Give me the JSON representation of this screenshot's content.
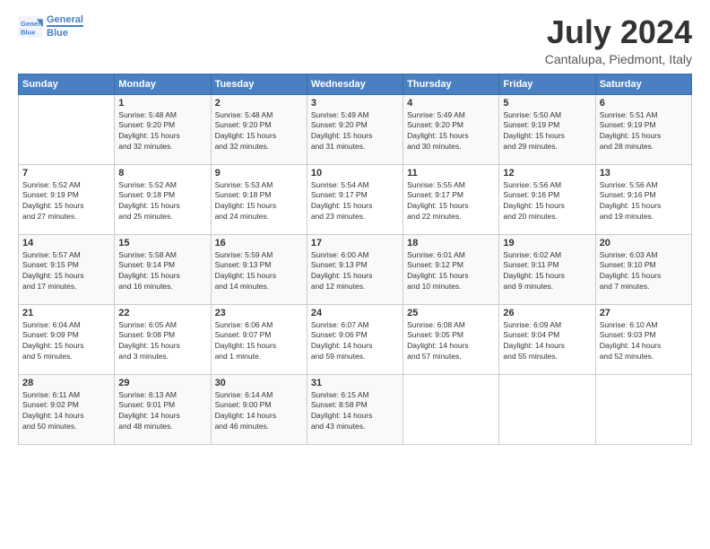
{
  "header": {
    "logo_line1": "General",
    "logo_line2": "Blue",
    "month_title": "July 2024",
    "location": "Cantalupa, Piedmont, Italy"
  },
  "weekdays": [
    "Sunday",
    "Monday",
    "Tuesday",
    "Wednesday",
    "Thursday",
    "Friday",
    "Saturday"
  ],
  "weeks": [
    [
      {
        "day": "",
        "info": ""
      },
      {
        "day": "1",
        "info": "Sunrise: 5:48 AM\nSunset: 9:20 PM\nDaylight: 15 hours\nand 32 minutes."
      },
      {
        "day": "2",
        "info": "Sunrise: 5:48 AM\nSunset: 9:20 PM\nDaylight: 15 hours\nand 32 minutes."
      },
      {
        "day": "3",
        "info": "Sunrise: 5:49 AM\nSunset: 9:20 PM\nDaylight: 15 hours\nand 31 minutes."
      },
      {
        "day": "4",
        "info": "Sunrise: 5:49 AM\nSunset: 9:20 PM\nDaylight: 15 hours\nand 30 minutes."
      },
      {
        "day": "5",
        "info": "Sunrise: 5:50 AM\nSunset: 9:19 PM\nDaylight: 15 hours\nand 29 minutes."
      },
      {
        "day": "6",
        "info": "Sunrise: 5:51 AM\nSunset: 9:19 PM\nDaylight: 15 hours\nand 28 minutes."
      }
    ],
    [
      {
        "day": "7",
        "info": "Sunrise: 5:52 AM\nSunset: 9:19 PM\nDaylight: 15 hours\nand 27 minutes."
      },
      {
        "day": "8",
        "info": "Sunrise: 5:52 AM\nSunset: 9:18 PM\nDaylight: 15 hours\nand 25 minutes."
      },
      {
        "day": "9",
        "info": "Sunrise: 5:53 AM\nSunset: 9:18 PM\nDaylight: 15 hours\nand 24 minutes."
      },
      {
        "day": "10",
        "info": "Sunrise: 5:54 AM\nSunset: 9:17 PM\nDaylight: 15 hours\nand 23 minutes."
      },
      {
        "day": "11",
        "info": "Sunrise: 5:55 AM\nSunset: 9:17 PM\nDaylight: 15 hours\nand 22 minutes."
      },
      {
        "day": "12",
        "info": "Sunrise: 5:56 AM\nSunset: 9:16 PM\nDaylight: 15 hours\nand 20 minutes."
      },
      {
        "day": "13",
        "info": "Sunrise: 5:56 AM\nSunset: 9:16 PM\nDaylight: 15 hours\nand 19 minutes."
      }
    ],
    [
      {
        "day": "14",
        "info": "Sunrise: 5:57 AM\nSunset: 9:15 PM\nDaylight: 15 hours\nand 17 minutes."
      },
      {
        "day": "15",
        "info": "Sunrise: 5:58 AM\nSunset: 9:14 PM\nDaylight: 15 hours\nand 16 minutes."
      },
      {
        "day": "16",
        "info": "Sunrise: 5:59 AM\nSunset: 9:13 PM\nDaylight: 15 hours\nand 14 minutes."
      },
      {
        "day": "17",
        "info": "Sunrise: 6:00 AM\nSunset: 9:13 PM\nDaylight: 15 hours\nand 12 minutes."
      },
      {
        "day": "18",
        "info": "Sunrise: 6:01 AM\nSunset: 9:12 PM\nDaylight: 15 hours\nand 10 minutes."
      },
      {
        "day": "19",
        "info": "Sunrise: 6:02 AM\nSunset: 9:11 PM\nDaylight: 15 hours\nand 9 minutes."
      },
      {
        "day": "20",
        "info": "Sunrise: 6:03 AM\nSunset: 9:10 PM\nDaylight: 15 hours\nand 7 minutes."
      }
    ],
    [
      {
        "day": "21",
        "info": "Sunrise: 6:04 AM\nSunset: 9:09 PM\nDaylight: 15 hours\nand 5 minutes."
      },
      {
        "day": "22",
        "info": "Sunrise: 6:05 AM\nSunset: 9:08 PM\nDaylight: 15 hours\nand 3 minutes."
      },
      {
        "day": "23",
        "info": "Sunrise: 6:06 AM\nSunset: 9:07 PM\nDaylight: 15 hours\nand 1 minute."
      },
      {
        "day": "24",
        "info": "Sunrise: 6:07 AM\nSunset: 9:06 PM\nDaylight: 14 hours\nand 59 minutes."
      },
      {
        "day": "25",
        "info": "Sunrise: 6:08 AM\nSunset: 9:05 PM\nDaylight: 14 hours\nand 57 minutes."
      },
      {
        "day": "26",
        "info": "Sunrise: 6:09 AM\nSunset: 9:04 PM\nDaylight: 14 hours\nand 55 minutes."
      },
      {
        "day": "27",
        "info": "Sunrise: 6:10 AM\nSunset: 9:03 PM\nDaylight: 14 hours\nand 52 minutes."
      }
    ],
    [
      {
        "day": "28",
        "info": "Sunrise: 6:11 AM\nSunset: 9:02 PM\nDaylight: 14 hours\nand 50 minutes."
      },
      {
        "day": "29",
        "info": "Sunrise: 6:13 AM\nSunset: 9:01 PM\nDaylight: 14 hours\nand 48 minutes."
      },
      {
        "day": "30",
        "info": "Sunrise: 6:14 AM\nSunset: 9:00 PM\nDaylight: 14 hours\nand 46 minutes."
      },
      {
        "day": "31",
        "info": "Sunrise: 6:15 AM\nSunset: 8:58 PM\nDaylight: 14 hours\nand 43 minutes."
      },
      {
        "day": "",
        "info": ""
      },
      {
        "day": "",
        "info": ""
      },
      {
        "day": "",
        "info": ""
      }
    ]
  ]
}
